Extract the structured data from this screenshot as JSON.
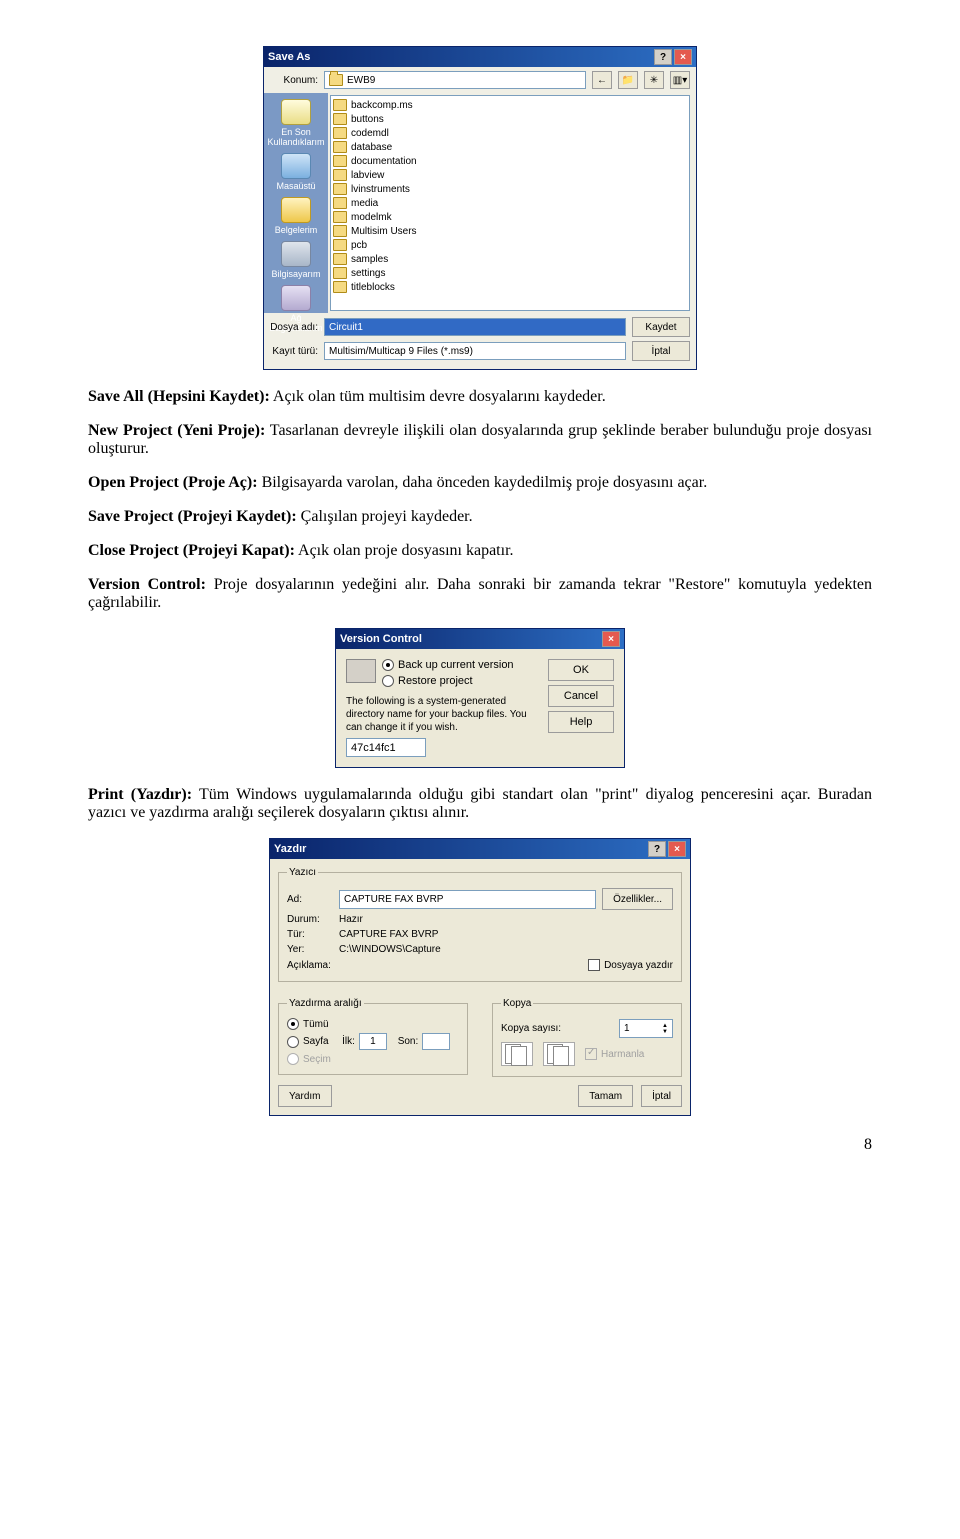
{
  "saveas": {
    "title": "Save As",
    "konum_label": "Konum:",
    "location": "EWB9",
    "places": {
      "recent": "En Son\nKullandıklarım",
      "desktop": "Masaüstü",
      "docs": "Belgelerim",
      "computer": "Bilgisayarım",
      "network": "Ağ Bağlantılarım"
    },
    "files": [
      "backcomp.ms",
      "buttons",
      "codemdl",
      "database",
      "documentation",
      "labview",
      "lvinstruments",
      "media",
      "modelmk",
      "Multisim Users",
      "pcb",
      "samples",
      "settings",
      "titleblocks"
    ],
    "filename_label": "Dosya adı:",
    "filename_value": "Circuit1",
    "filetype_label": "Kayıt türü:",
    "filetype_value": "Multisim/Multicap 9 Files (*.ms9)",
    "save_btn": "Kaydet",
    "cancel_btn": "İptal"
  },
  "para_saveall_b": "Save All (Hepsini Kaydet):",
  "para_saveall": " Açık olan tüm multisim devre dosyalarını kaydeder.",
  "para_newproj_b": "New Project (Yeni Proje):",
  "para_newproj": " Tasarlanan devreyle ilişkili olan dosyalarında grup şeklinde beraber bulunduğu proje dosyası oluşturur.",
  "para_openproj_b": "Open Project (Proje Aç):",
  "para_openproj": " Bilgisayarda varolan, daha önceden kaydedilmiş proje dosyasını açar.",
  "para_saveproj_b": "Save Project (Projeyi Kaydet):",
  "para_saveproj": " Çalışılan projeyi kaydeder.",
  "para_closeproj_b": "Close Project (Projeyi Kapat):",
  "para_closeproj": " Açık olan proje dosyasını kapatır.",
  "para_version_b": "Version Control:",
  "para_version": " Proje dosyalarının yedeğini alır. Daha sonraki bir zamanda tekrar \"Restore\" komutuyla yedekten çağrılabilir.",
  "vc": {
    "title": "Version Control",
    "opt_backup": "Back up current version",
    "opt_restore": "Restore project",
    "text": "The following is a system-generated directory name for your backup files. You can change it if you wish.",
    "value": "47c14fc1",
    "ok": "OK",
    "cancel": "Cancel",
    "help": "Help"
  },
  "para_print_b": "Print (Yazdır):",
  "para_print": " Tüm Windows uygulamalarında olduğu gibi standart olan \"print\" diyalog penceresini açar. Buradan yazıcı ve yazdırma aralığı seçilerek dosyaların çıktısı alınır.",
  "print": {
    "title": "Yazdır",
    "group_printer": "Yazıcı",
    "lbl_name": "Ad:",
    "printer_name": "CAPTURE FAX BVRP",
    "btn_props": "Özellikler...",
    "lbl_status": "Durum:",
    "val_status": "Hazır",
    "lbl_type": "Tür:",
    "val_type": "CAPTURE FAX BVRP",
    "lbl_where": "Yer:",
    "val_where": "C:\\WINDOWS\\Capture",
    "lbl_comment": "Açıklama:",
    "chk_tofile": "Dosyaya yazdır",
    "group_range": "Yazdırma aralığı",
    "opt_all": "Tümü",
    "opt_pages": "Sayfa",
    "lbl_from": "İlk:",
    "val_from": "1",
    "lbl_to": "Son:",
    "val_to": "",
    "opt_selection": "Seçim",
    "group_copy": "Kopya",
    "lbl_copies": "Kopya sayısı:",
    "val_copies": "1",
    "chk_collate": "Harmanla",
    "btn_help": "Yardım",
    "btn_ok": "Tamam",
    "btn_cancel": "İptal"
  },
  "page_number": "8"
}
